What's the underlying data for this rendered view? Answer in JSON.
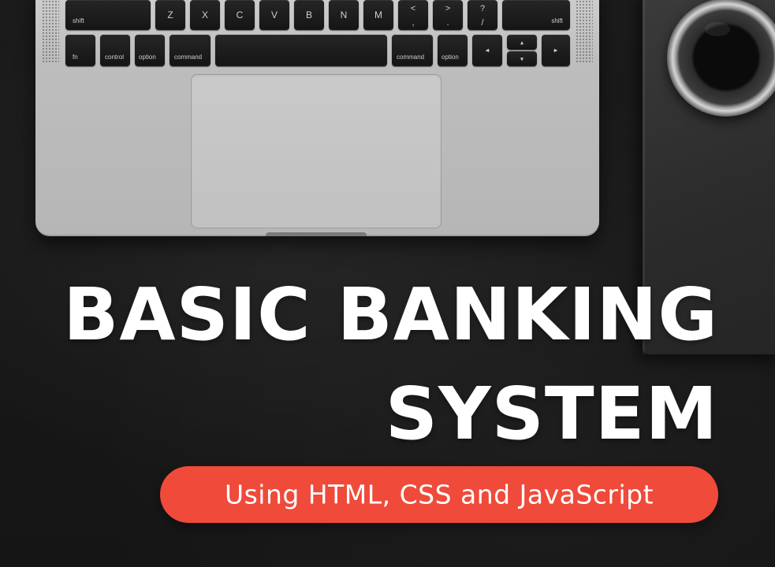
{
  "banner": {
    "title_line1": "BASIC BANKING",
    "title_line2": "SYSTEM",
    "subtitle": "Using HTML, CSS and JavaScript",
    "accent_color": "#f04a3a"
  },
  "keyboard": {
    "row1": {
      "shift_left": "shift",
      "z": "Z",
      "x": "X",
      "c": "C",
      "v": "V",
      "b": "B",
      "n": "N",
      "m": "M",
      "comma_top": "<",
      "comma_bottom": ",",
      "period_top": ">",
      "period_bottom": ".",
      "slash_top": "?",
      "slash_bottom": "/",
      "shift_right": "shift"
    },
    "row2": {
      "fn": "fn",
      "control": "control",
      "option_left": "option",
      "command_left": "command",
      "command_right": "command",
      "option_right": "option",
      "arrow_left": "◂",
      "arrow_up": "▴",
      "arrow_down": "▾",
      "arrow_right": "▸"
    }
  }
}
